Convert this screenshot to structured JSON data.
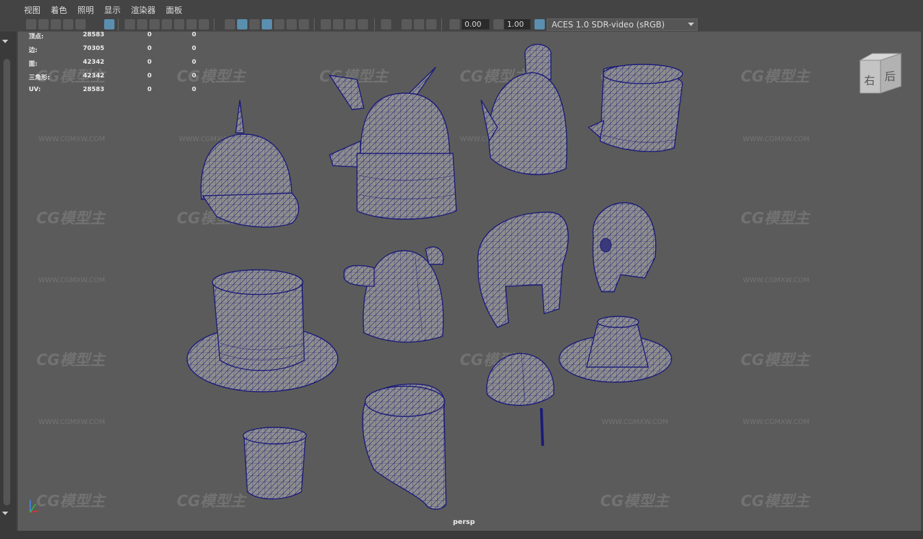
{
  "menu": [
    "视图",
    "着色",
    "照明",
    "显示",
    "渲染器",
    "面板"
  ],
  "toolbar": {
    "exposure": "0.00",
    "gamma": "1.00",
    "color_space": "ACES 1.0 SDR-video (sRGB)"
  },
  "hud": {
    "rows": [
      {
        "label": "顶点:",
        "v1": "28583",
        "v2": "0",
        "v3": "0"
      },
      {
        "label": "边:",
        "v1": "70305",
        "v2": "0",
        "v3": "0"
      },
      {
        "label": "面:",
        "v1": "42342",
        "v2": "0",
        "v3": "0"
      },
      {
        "label": "三角形:",
        "v1": "42342",
        "v2": "0",
        "v3": "0"
      },
      {
        "label": "UV:",
        "v1": "28583",
        "v2": "0",
        "v3": "0"
      }
    ]
  },
  "view_cube": {
    "face_left": "右",
    "face_right": "后"
  },
  "watermark": {
    "brand": "CG模型主",
    "url": "WWW.CGMXW.COM"
  },
  "camera": "persp",
  "colors": {
    "viewport_bg": "#5b5b5b",
    "wireframe": "#1b1b7a",
    "mesh": "#8e8e8e",
    "accent": "#5a8fb0"
  }
}
